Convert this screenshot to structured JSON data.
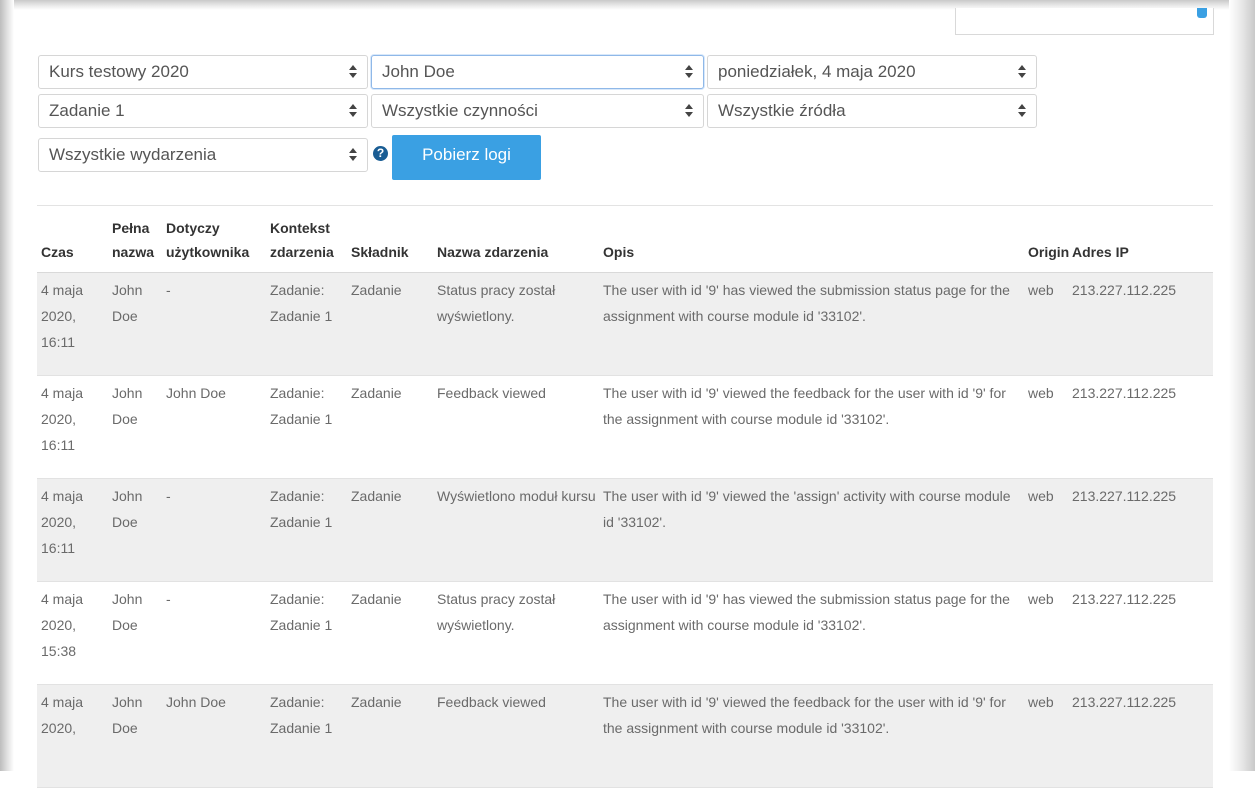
{
  "filters": {
    "course": "Kurs testowy 2020",
    "user": "John Doe",
    "date": "poniedziałek, 4 maja 2020",
    "activity": "Zadanie 1",
    "actions": "Wszystkie czynności",
    "sources": "Wszystkie źródła",
    "events": "Wszystkie wydarzenia",
    "help_icon": "question-circle-icon",
    "get_logs_label": "Pobierz logi"
  },
  "table": {
    "headers": {
      "time": "Czas",
      "fullname": "Pełna nazwa",
      "affected_user": "Dotyczy użytkownika",
      "context": "Kontekst zdarzenia",
      "component": "Składnik",
      "event_name": "Nazwa zdarzenia",
      "description": "Opis",
      "origin": "Origin",
      "ip": "Adres IP"
    },
    "rows": [
      {
        "time": "4 maja 2020, 16:11",
        "fullname": "John Doe",
        "affected_user": "-",
        "context": "Zadanie: Zadanie 1",
        "component": "Zadanie",
        "event_name": "Status pracy został wyświetlony.",
        "description": "The user with id '9' has viewed the submission status page for the assignment with course module id '33102'.",
        "origin": "web",
        "ip": "213.227.112.225"
      },
      {
        "time": "4 maja 2020, 16:11",
        "fullname": "John Doe",
        "affected_user": "John Doe",
        "context": "Zadanie: Zadanie 1",
        "component": "Zadanie",
        "event_name": "Feedback viewed",
        "description": "The user with id '9' viewed the feedback for the user with id '9' for the assignment with course module id '33102'.",
        "origin": "web",
        "ip": "213.227.112.225"
      },
      {
        "time": "4 maja 2020, 16:11",
        "fullname": "John Doe",
        "affected_user": "-",
        "context": "Zadanie: Zadanie 1",
        "component": "Zadanie",
        "event_name": "Wyświetlono moduł kursu",
        "description": "The user with id '9' viewed the 'assign' activity with course module id '33102'.",
        "origin": "web",
        "ip": "213.227.112.225"
      },
      {
        "time": "4 maja 2020, 15:38",
        "fullname": "John Doe",
        "affected_user": "-",
        "context": "Zadanie: Zadanie 1",
        "component": "Zadanie",
        "event_name": "Status pracy został wyświetlony.",
        "description": "The user with id '9' has viewed the submission status page for the assignment with course module id '33102'.",
        "origin": "web",
        "ip": "213.227.112.225"
      },
      {
        "time": "4 maja 2020,",
        "fullname": "John Doe",
        "affected_user": "John Doe",
        "context": "Zadanie: Zadanie 1",
        "component": "Zadanie",
        "event_name": "Feedback viewed",
        "description": "The user with id '9' viewed the feedback for the user with id '9' for the assignment with course module id '33102'.",
        "origin": "web",
        "ip": "213.227.112.225"
      }
    ]
  },
  "colors": {
    "accent": "#3aa0e3",
    "help_icon": "#1a5d94",
    "row_stripe": "#efefef"
  }
}
